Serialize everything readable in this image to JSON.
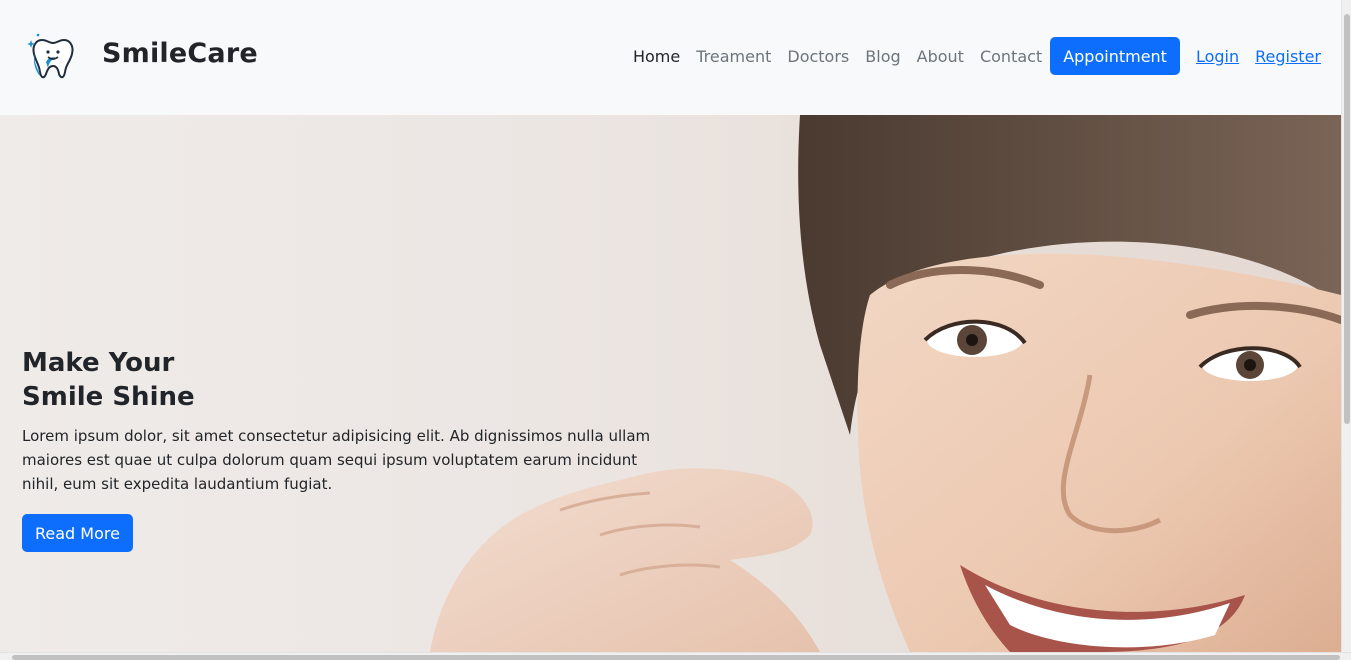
{
  "brand": {
    "name": "SmileCare",
    "logo": "tooth-logo-icon"
  },
  "nav": {
    "items": [
      "Home",
      "Treament",
      "Doctors",
      "Blog",
      "About",
      "Contact"
    ],
    "appointment_label": "Appointment",
    "login_label": "Login",
    "register_label": "Register"
  },
  "hero": {
    "title_line1": "Make Your",
    "title_line2": "Smile Shine",
    "text": "Lorem ipsum dolor, sit amet consectetur adipisicing elit. Ab dignissimos nulla ullam maiores est quae ut culpa dolorum quam sequi ipsum voluptatem earum incidunt nihil, eum sit expedita laudantium fugiat.",
    "button_label": "Read More",
    "image": "smiling-woman-photo"
  },
  "colors": {
    "primary": "#0d6efd",
    "navbar_bg": "#f8f9fa",
    "text_dark": "#212529",
    "text_muted": "#6c757d"
  }
}
